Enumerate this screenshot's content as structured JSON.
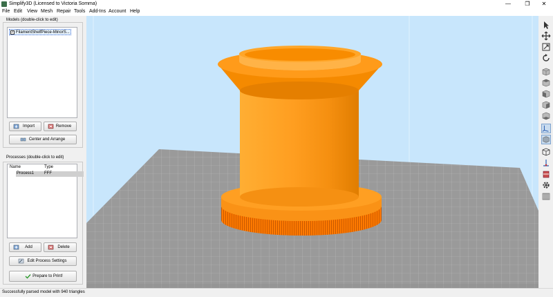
{
  "window": {
    "title": "Simplify3D (Licensed to Victoria Somma)",
    "controls": {
      "minimize": "—",
      "maximize": "❐",
      "close": "✕"
    }
  },
  "menu": {
    "items": [
      "File",
      "Edit",
      "View",
      "Mesh",
      "Repair",
      "Tools",
      "Add-Ins",
      "Account",
      "Help"
    ]
  },
  "models_panel": {
    "title": "Models (double-click to edit)",
    "items": [
      {
        "name": "FilamentShelfPiece-MinorS...",
        "checked": true
      }
    ],
    "import_label": "Import",
    "remove_label": "Remove",
    "center_label": "Center and Arrange"
  },
  "processes_panel": {
    "title": "Processes (double-click to edit)",
    "columns": {
      "name": "Name",
      "type": "Type"
    },
    "rows": [
      {
        "name": "Process1",
        "type": "FFF"
      }
    ],
    "add_label": "Add",
    "delete_label": "Delete",
    "edit_label": "Edit Process Settings",
    "prepare_label": "Prepare to Print!"
  },
  "status": {
    "text": "Successfully parsed model with 940 triangles"
  },
  "right_toolbar": {
    "tools": [
      "select-arrow-icon",
      "move-icon",
      "scale-icon",
      "rotate-icon",
      "view-default-icon",
      "view-top-icon",
      "view-front-icon",
      "view-side-icon",
      "view-bottom-icon",
      "axes-icon",
      "render-solid-icon",
      "build-volume-icon",
      "origin-icon",
      "cross-section-icon",
      "settings-gear-icon",
      "supports-icon"
    ],
    "active": [
      "axes-icon",
      "render-solid-icon"
    ]
  },
  "colors": {
    "viewport_bg": "#c8e6fc",
    "bed": "#999999",
    "model": "#ff9a1c",
    "model_dark": "#e07000",
    "accent": "#3a6bd5"
  }
}
